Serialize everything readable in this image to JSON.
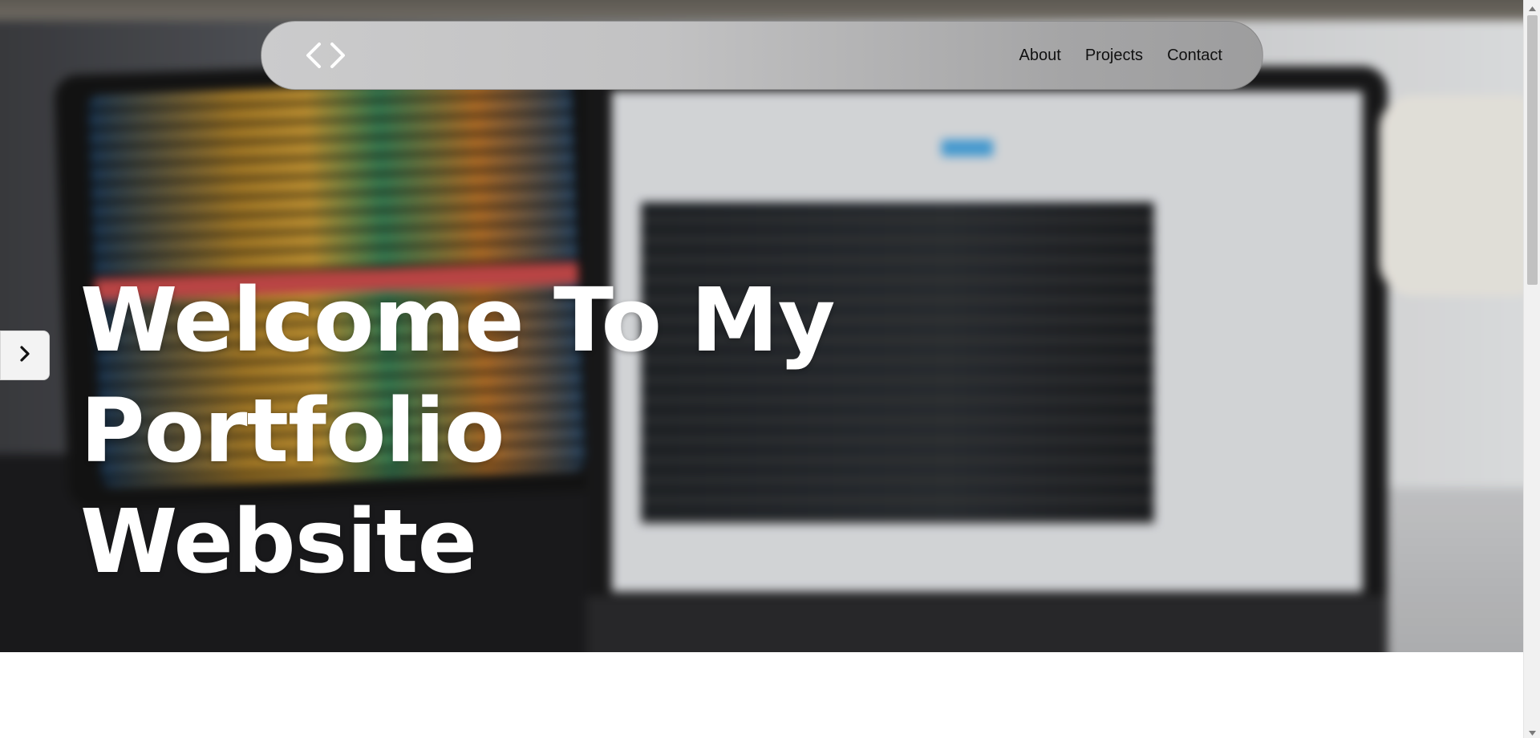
{
  "navbar": {
    "logo_icon": "code-brackets-icon",
    "links": [
      {
        "label": "About"
      },
      {
        "label": "Projects"
      },
      {
        "label": "Contact"
      }
    ]
  },
  "hero": {
    "title_line1": "Welcome To My",
    "title_line2": "Portfolio Website",
    "background": "blurred-desk-photo"
  },
  "side_toggle": {
    "icon": "chevron-right-icon"
  },
  "scrollbar": {
    "up_icon": "triangle-up-icon",
    "down_icon": "triangle-down-icon"
  },
  "colors": {
    "title": "#ffffff",
    "nav_text": "#111111",
    "navbar_bg": "#c2c2c3"
  }
}
